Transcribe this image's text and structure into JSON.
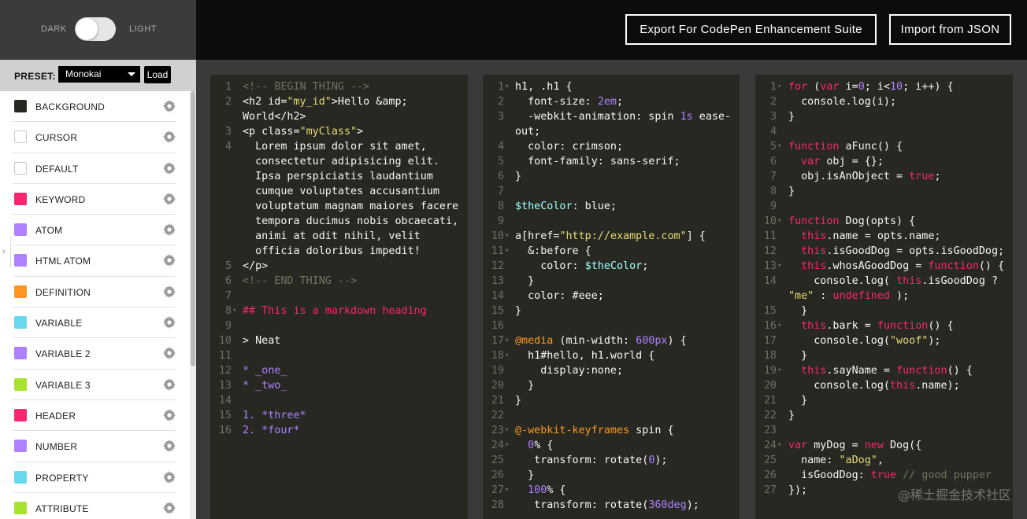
{
  "theme": {
    "dark_label": "DARK",
    "light_label": "LIGHT"
  },
  "toolbar": {
    "export_label": "Export For CodePen Enhancement Suite",
    "import_label": "Import from JSON"
  },
  "preset": {
    "label": "PRESET:",
    "selected": "Monokai",
    "load_label": "Load"
  },
  "colors": [
    {
      "name": "BACKGROUND",
      "swatch": "#272822"
    },
    {
      "name": "CURSOR",
      "swatch": "#ffffff"
    },
    {
      "name": "DEFAULT",
      "swatch": "#ffffff"
    },
    {
      "name": "KEYWORD",
      "swatch": "#f92672"
    },
    {
      "name": "ATOM",
      "swatch": "#ae81ff"
    },
    {
      "name": "HTML ATOM",
      "swatch": "#ae81ff"
    },
    {
      "name": "DEFINITION",
      "swatch": "#fd971f"
    },
    {
      "name": "VARIABLE",
      "swatch": "#66d9ef"
    },
    {
      "name": "VARIABLE 2",
      "swatch": "#ae81ff"
    },
    {
      "name": "VARIABLE 3",
      "swatch": "#a6e22e"
    },
    {
      "name": "HEADER",
      "swatch": "#f92672"
    },
    {
      "name": "NUMBER",
      "swatch": "#ae81ff"
    },
    {
      "name": "PROPERTY",
      "swatch": "#66d9ef"
    },
    {
      "name": "ATTRIBUTE",
      "swatch": "#a6e22e"
    }
  ],
  "html_panel": [
    {
      "n": "1",
      "text": "<!-- BEGIN THING -->"
    },
    {
      "n": "2",
      "text": "<h2 id=\"my_id\">Hello &amp;"
    },
    {
      "n": "",
      "text": "World</h2>"
    },
    {
      "n": "3",
      "text": "<p class=\"myClass\">"
    },
    {
      "n": "4",
      "text": "  Lorem ipsum dolor sit amet,"
    },
    {
      "n": "",
      "text": "  consectetur adipisicing elit."
    },
    {
      "n": "",
      "text": "  Ipsa perspiciatis laudantium"
    },
    {
      "n": "",
      "text": "  cumque voluptates accusantium"
    },
    {
      "n": "",
      "text": "  voluptatum magnam maiores facere"
    },
    {
      "n": "",
      "text": "  tempora ducimus nobis obcaecati,"
    },
    {
      "n": "",
      "text": "  animi at odit nihil, velit"
    },
    {
      "n": "",
      "text": "  officia doloribus impedit!"
    },
    {
      "n": "5",
      "text": "</p>"
    },
    {
      "n": "6",
      "text": "<!-- END THING -->"
    },
    {
      "n": "7",
      "text": ""
    },
    {
      "n": "8",
      "text": "## This is a markdown heading"
    },
    {
      "n": "9",
      "text": ""
    },
    {
      "n": "10",
      "text": "> Neat"
    },
    {
      "n": "11",
      "text": ""
    },
    {
      "n": "12",
      "text": "* _one_"
    },
    {
      "n": "13",
      "text": "* _two_"
    },
    {
      "n": "14",
      "text": ""
    },
    {
      "n": "15",
      "text": "1. *three*"
    },
    {
      "n": "16",
      "text": "2. *four*"
    }
  ],
  "css_panel": [
    {
      "n": "1",
      "text": "h1, .h1 {"
    },
    {
      "n": "2",
      "text": "  font-size: 2em;"
    },
    {
      "n": "3",
      "text": "  -webkit-animation: spin 1s ease-"
    },
    {
      "n": "",
      "text": "out;"
    },
    {
      "n": "4",
      "text": "  color: crimson;"
    },
    {
      "n": "5",
      "text": "  font-family: sans-serif;"
    },
    {
      "n": "6",
      "text": "}"
    },
    {
      "n": "7",
      "text": ""
    },
    {
      "n": "8",
      "text": "$theColor: blue;"
    },
    {
      "n": "9",
      "text": ""
    },
    {
      "n": "10",
      "text": "a[href=\"http://example.com\"] {"
    },
    {
      "n": "11",
      "text": "  &:before {"
    },
    {
      "n": "12",
      "text": "    color: $theColor;"
    },
    {
      "n": "13",
      "text": "  }"
    },
    {
      "n": "14",
      "text": "  color: #eee;"
    },
    {
      "n": "15",
      "text": "}"
    },
    {
      "n": "16",
      "text": ""
    },
    {
      "n": "17",
      "text": "@media (min-width: 600px) {"
    },
    {
      "n": "18",
      "text": "  h1#hello, h1.world {"
    },
    {
      "n": "19",
      "text": "    display:none;"
    },
    {
      "n": "20",
      "text": "  }"
    },
    {
      "n": "21",
      "text": "}"
    },
    {
      "n": "22",
      "text": ""
    },
    {
      "n": "23",
      "text": "@-webkit-keyframes spin {"
    },
    {
      "n": "24",
      "text": "  0% {"
    },
    {
      "n": "25",
      "text": "   transform: rotate(0);"
    },
    {
      "n": "26",
      "text": "  }"
    },
    {
      "n": "27",
      "text": "  100% {"
    },
    {
      "n": "28",
      "text": "   transform: rotate(360deg);"
    }
  ],
  "js_panel": [
    {
      "n": "1",
      "text": "for (var i=0; i<10; i++) {"
    },
    {
      "n": "2",
      "text": "  console.log(i);"
    },
    {
      "n": "3",
      "text": "}"
    },
    {
      "n": "4",
      "text": ""
    },
    {
      "n": "5",
      "text": "function aFunc() {"
    },
    {
      "n": "6",
      "text": "  var obj = {};"
    },
    {
      "n": "7",
      "text": "  obj.isAnObject = true;"
    },
    {
      "n": "8",
      "text": "}"
    },
    {
      "n": "9",
      "text": ""
    },
    {
      "n": "10",
      "text": "function Dog(opts) {"
    },
    {
      "n": "11",
      "text": "  this.name = opts.name;"
    },
    {
      "n": "12",
      "text": "  this.isGoodDog = opts.isGoodDog;"
    },
    {
      "n": "13",
      "text": "  this.whosAGoodDog = function() {"
    },
    {
      "n": "14",
      "text": "    console.log( this.isGoodDog ?"
    },
    {
      "n": "",
      "text": "\"me\" : undefined );"
    },
    {
      "n": "15",
      "text": "  }"
    },
    {
      "n": "16",
      "text": "  this.bark = function() {"
    },
    {
      "n": "17",
      "text": "    console.log(\"woof\");"
    },
    {
      "n": "18",
      "text": "  }"
    },
    {
      "n": "19",
      "text": "  this.sayName = function() {"
    },
    {
      "n": "20",
      "text": "    console.log(this.name);"
    },
    {
      "n": "21",
      "text": "  }"
    },
    {
      "n": "22",
      "text": "}"
    },
    {
      "n": "23",
      "text": ""
    },
    {
      "n": "24",
      "text": "var myDog = new Dog({"
    },
    {
      "n": "25",
      "text": "  name: \"aDog\","
    },
    {
      "n": "26",
      "text": "  isGoodDog: true // good pupper"
    },
    {
      "n": "27",
      "text": "});"
    }
  ],
  "watermark": "@稀土掘金技术社区"
}
